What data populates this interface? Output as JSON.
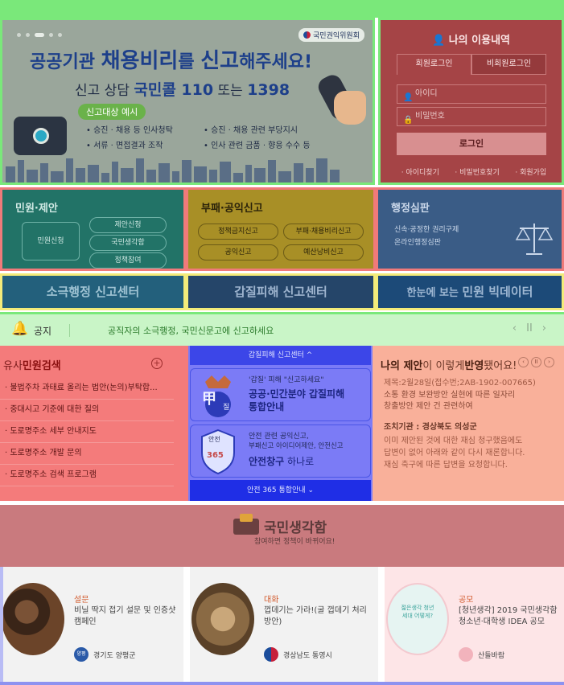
{
  "banner": {
    "logo_text": "국민권익위원회",
    "headline_prefix": "공공기관 ",
    "headline_big": "채용비리",
    "headline_mid": "를 ",
    "headline_big2": "신고",
    "headline_suffix": "해주세요!",
    "consult_label": "신고 상담 ",
    "consult_name": "국민콜 110",
    "consult_or": " 또는 ",
    "consult_num2": "1398",
    "tag": "신고대상 예시",
    "items": [
      "승진 · 채용 등 인사청탁",
      "승진 · 채용 관련 부당지시",
      "서류 · 면접결과 조작",
      "인사 관련 금품 · 향응 수수 등"
    ]
  },
  "login": {
    "title": "나의 이용내역",
    "tab_member": "회원로그인",
    "tab_nonmember": "비회원로그인",
    "id_placeholder": "아이디",
    "pw_placeholder": "비밀번호",
    "button": "로그인",
    "links": [
      "아이디찾기",
      "비밀번호찾기",
      "회원가입"
    ]
  },
  "panels": {
    "civil": {
      "title": "민원·제안",
      "box": "민원신청",
      "pills": [
        "제안신청",
        "국민생각함",
        "정책참여"
      ]
    },
    "corruption": {
      "title": "부패·공익신고",
      "pills": [
        "정책금지신고",
        "부패·채용비리신고",
        "공익신고",
        "예산낭비신고"
      ]
    },
    "admin": {
      "title": "행정심판",
      "links": [
        "신속·공정한 권리구제",
        "온라인행정심판"
      ]
    }
  },
  "bars": {
    "b1": "소극행정 신고센터",
    "b2": "갑질피해 신고센터",
    "b3_prefix": "한눈에 보는 ",
    "b3_bold": "민원 빅데이터"
  },
  "notice": {
    "label": "공지",
    "message": "공직자의 소극행정, 국민신문고에 신고하세요",
    "prev": "‹",
    "pause": "II",
    "next": "›"
  },
  "search": {
    "title_prefix": "유사",
    "title_bold": "민원검색",
    "items": [
      "불법주차 과태료 올리는 법안(논의)부탁합...",
      "중대시고 기준에 대한 질의",
      "도로명주소 세부 안내지도",
      "도로명주소 개발 문의",
      "도로명주소 검색 프로그램"
    ]
  },
  "center": {
    "top": "갑질피해 신고센터 ^",
    "card1_small": "'갑질' 피해 \"신고하세요\"",
    "card1_big1": "공공·민간분야 갑질피해",
    "card1_big2": "통합안내",
    "card1_badge": "甲",
    "card1_badge2": "질",
    "card2_small1": "안전 관련 공익신고,",
    "card2_small2": "부패신고 아이디어제안, 안전신고",
    "card2_big": "안전창구",
    "card2_big_suffix": " 하나로",
    "card2_badge_top": "안전",
    "card2_badge_num": "365",
    "bottom": "안전 365 통합안내 ⌄"
  },
  "proposal": {
    "title_prefix": "나의 제안",
    "title_mid": "이 이렇게",
    "title_bold": "반영",
    "title_suffix": "됐어요!",
    "nav": [
      "‹",
      "II",
      "›"
    ],
    "meta": "제목:2월28일(접수번;2AB-1902-007665)",
    "line1": "소통 환경 보완방안 실현에 따른 일자리",
    "line2": "창출방안 제안 건 관련하여",
    "org": "조치기관 : 경상북도 의성군",
    "body1": "이미 제안된 것에 대한 재심 청구했음에도",
    "body2": "답변이 없어 아래와 같이 다시 재론합니다.",
    "body3": "재심 축구에 따른 답변을 요청합니다."
  },
  "gukmin": {
    "title": "국민생각함",
    "subtitle": "참여하면 정책이 바뀌어요!"
  },
  "cards": [
    {
      "category": "설문",
      "text": "비닐 딱지 접기 설문 및 인증샷 캠페인",
      "org": "경기도 양평군",
      "org_mark": "양평"
    },
    {
      "category": "대화",
      "text": "껍데기는 가라!(굴 껍데기 처리 방안)",
      "org": "경상남도 통영시",
      "org_mark": ""
    },
    {
      "category": "공모",
      "text": "[청년생각] 2019 국민생각함 청소년·대학생 IDEA 공모",
      "org": "산들바람",
      "org_mark": "",
      "img_text": "젊은생각 청년세대 어떻게?"
    }
  ],
  "colors": {
    "accent_green": "#7ae87a",
    "login_red": "#a54446",
    "notice_green": "#c9f5c7",
    "center_blue": "#7b7bf6"
  }
}
